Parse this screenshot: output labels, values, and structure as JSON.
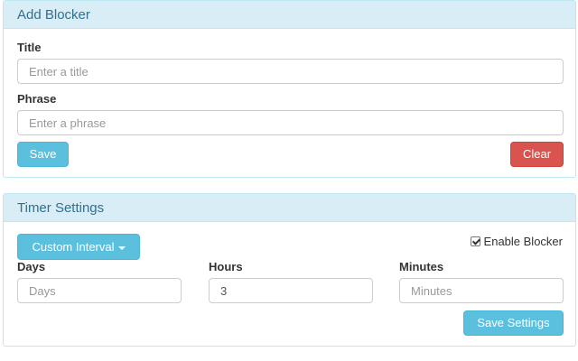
{
  "add_blocker": {
    "heading": "Add Blocker",
    "title_label": "Title",
    "title_placeholder": "Enter a title",
    "phrase_label": "Phrase",
    "phrase_placeholder": "Enter a phrase",
    "save_label": "Save",
    "clear_label": "Clear"
  },
  "timer_settings": {
    "heading": "Timer Settings",
    "interval_button_label": "Custom Interval",
    "enable_blocker_label": "Enable Blocker",
    "enable_blocker_checked": true,
    "days_label": "Days",
    "days_placeholder": "Days",
    "days_value": "",
    "hours_label": "Hours",
    "hours_value": "3",
    "minutes_label": "Minutes",
    "minutes_placeholder": "Minutes",
    "minutes_value": "",
    "save_settings_label": "Save Settings"
  },
  "colors": {
    "panel_heading_bg": "#d9edf7",
    "panel_border": "#bce8f1",
    "heading_text": "#31708f",
    "info_button": "#5bc0de",
    "danger_button": "#d9534f"
  }
}
